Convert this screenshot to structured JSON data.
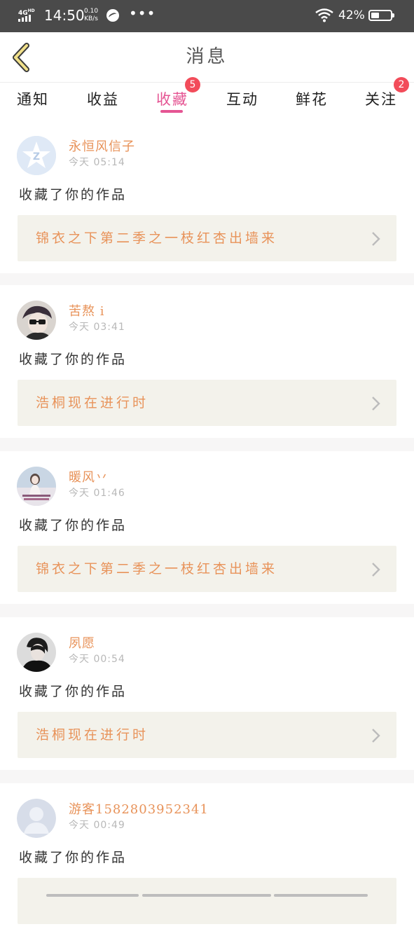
{
  "status_bar": {
    "network": "4G",
    "network_sub": "HD",
    "time": "14:50",
    "speed_value": "0.10",
    "speed_unit": "KB/s",
    "dots": "•••",
    "battery_percent": "42%",
    "battery_level": 0.42
  },
  "nav": {
    "title": "消息",
    "back_icon": "chevron-left-icon"
  },
  "tabs": [
    {
      "label": "通知",
      "active": false
    },
    {
      "label": "收益",
      "active": false
    },
    {
      "label": "收藏",
      "active": true,
      "badge": "5"
    },
    {
      "label": "互动",
      "active": false
    },
    {
      "label": "鲜花",
      "active": false
    },
    {
      "label": "关注",
      "active": false,
      "badge": "2"
    }
  ],
  "colors": {
    "accent": "#e55593",
    "name_color": "#e8935a",
    "badge": "#f24c5a",
    "link_bg": "#f3f2eb"
  },
  "messages": [
    {
      "user": "永恒风信子",
      "time": "今天 05:14",
      "action": "收藏了你的作品",
      "work": "锦衣之下第二季之一枝红杏出墙来",
      "avatar": "qq-avatar"
    },
    {
      "user": "苦熬 i",
      "time": "今天 03:41",
      "action": "收藏了你的作品",
      "work": "浩桐现在进行时",
      "avatar": "photo-avatar"
    },
    {
      "user": "暖风丷",
      "time": "今天 01:46",
      "action": "收藏了你的作品",
      "work": "锦衣之下第二季之一枝红杏出墙来",
      "avatar": "photo-avatar"
    },
    {
      "user": "夙愿",
      "time": "今天 00:54",
      "action": "收藏了你的作品",
      "work": "浩桐现在进行时",
      "avatar": "photo-avatar"
    },
    {
      "user": "游客1582803952341",
      "time": "今天 00:49",
      "action": "收藏了你的作品",
      "work": "",
      "avatar": "default-avatar"
    }
  ]
}
